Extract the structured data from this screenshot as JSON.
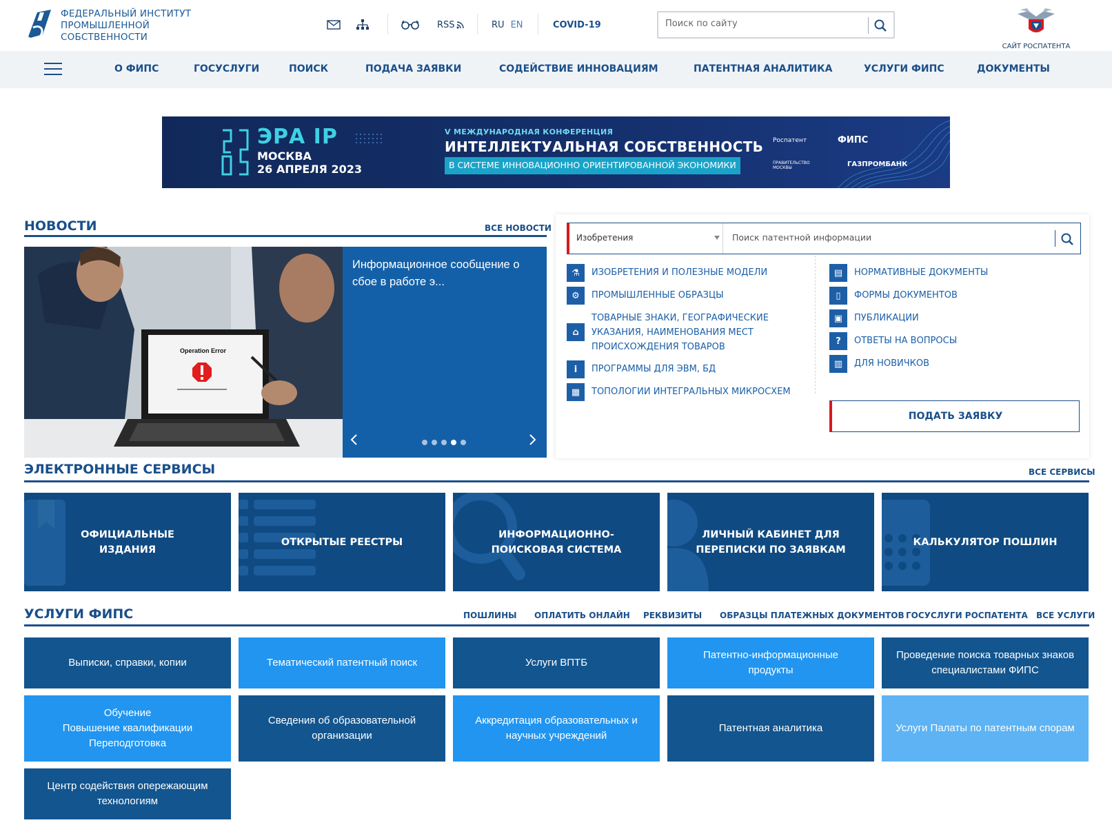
{
  "header": {
    "logo_lines": [
      "ФЕДЕРАЛЬНЫЙ ИНСТИТУТ",
      "ПРОМЫШЛЕННОЙ",
      "СОБСТВЕННОСТИ"
    ],
    "rss_label": "RSS",
    "lang_ru": "RU",
    "lang_en": "EN",
    "covid_label": "COVID-19",
    "search_placeholder": "Поиск по сайту",
    "rospatent_label": "САЙТ РОСПАТЕНТА"
  },
  "nav": {
    "items": [
      "О ФИПС",
      "ГОСУСЛУГИ",
      "ПОИСК",
      "ПОДАЧА ЗАЯВКИ",
      "СОДЕЙСТВИЕ ИННОВАЦИЯМ",
      "ПАТЕНТНАЯ АНАЛИТИКА",
      "УСЛУГИ ФИПС",
      "ДОКУМЕНТЫ"
    ]
  },
  "banner": {
    "era": "ЭРА IP",
    "city": "МОСКВА",
    "date": "26 АПРЕЛЯ 2023",
    "conf_small": "V МЕЖДУНАРОДНАЯ КОНФЕРЕНЦИЯ",
    "conf_title": "ИНТЕЛЛЕКТУАЛЬНАЯ СОБСТВЕННОСТЬ",
    "conf_sub": "В СИСТЕМЕ ИННОВАЦИОННО ОРИЕНТИРОВАННОЙ ЭКОНОМИКИ",
    "partners": [
      "Роспатент",
      "ФИПС",
      "ПРАВИТЕЛЬСТВО МОСКВЫ",
      "ГАЗПРОМБАНК"
    ]
  },
  "news": {
    "title": "НОВОСТИ",
    "all_link": "ВСЕ НОВОСТИ",
    "item_text": "Информационное сообщение о сбое в работе э...",
    "photo_caption": "Operation Error",
    "slides_total": 5,
    "slide_active": 4
  },
  "patent_search": {
    "select_value": "Изобретения",
    "placeholder": "Поиск патентной информации",
    "left_links": [
      "ИЗОБРЕТЕНИЯ И ПОЛЕЗНЫЕ МОДЕЛИ",
      "ПРОМЫШЛЕННЫЕ ОБРАЗЦЫ",
      "ТОВАРНЫЕ ЗНАКИ, ГЕОГРАФИЧЕСКИЕ УКАЗАНИЯ, НАИМЕНОВАНИЯ МЕСТ ПРОИСХОЖДЕНИЯ ТОВАРОВ",
      "ПРОГРАММЫ ДЛЯ ЭВМ, БД",
      "ТОПОЛОГИИ ИНТЕГРАЛЬНЫХ МИКРОСХЕМ"
    ],
    "right_links": [
      "НОРМАТИВНЫЕ ДОКУМЕНТЫ",
      "ФОРМЫ ДОКУМЕНТОВ",
      "ПУБЛИКАЦИИ",
      "ОТВЕТЫ НА ВОПРОСЫ",
      "ДЛЯ НОВИЧКОВ"
    ],
    "apply_label": "ПОДАТЬ ЗАЯВКУ"
  },
  "eservices": {
    "title": "ЭЛЕКТРОННЫЕ СЕРВИСЫ",
    "all_link": "ВСЕ СЕРВИСЫ",
    "tiles": [
      "ОФИЦИАЛЬНЫЕ ИЗДАНИЯ",
      "ОТКРЫТЫЕ РЕЕСТРЫ",
      "ИНФОРМАЦИОННО-ПОИСКОВАЯ СИСТЕМА",
      "ЛИЧНЫЙ КАБИНЕТ ДЛЯ ПЕРЕПИСКИ ПО ЗАЯВКАМ",
      "КАЛЬКУЛЯТОР ПОШЛИН"
    ]
  },
  "services": {
    "title": "УСЛУГИ ФИПС",
    "links": [
      "ПОШЛИНЫ",
      "ОПЛАТИТЬ ОНЛАЙН",
      "РЕКВИЗИТЫ",
      "ОБРАЗЦЫ ПЛАТЕЖНЫХ ДОКУМЕНТОВ",
      "ГОСУСЛУГИ РОСПАТЕНТА",
      "ВСЕ УСЛУГИ"
    ],
    "tiles": [
      "Выписки, справки, копии",
      "Тематический патентный поиск",
      "Услуги ВПТБ",
      "Патентно-информационные продукты",
      "Проведение поиска товарных знаков специалистами ФИПС",
      "Обучение\nПовышение квалификации\nПереподготовка",
      "Сведения об образовательной организации",
      "Аккредитация образовательных и научных учреждений",
      "Патентная аналитика",
      "Услуги Палаты по патентным спорам",
      "Центр содействия опережающим технологиям"
    ]
  },
  "colors": {
    "brand": "#1a4f8a",
    "accent_red": "#d71920",
    "tile_dark": "#12558f",
    "tile_bright": "#2195f0",
    "tile_light": "#5db3f3",
    "eservice_bg": "#0f4a82",
    "news_panel": "#1460a8"
  }
}
